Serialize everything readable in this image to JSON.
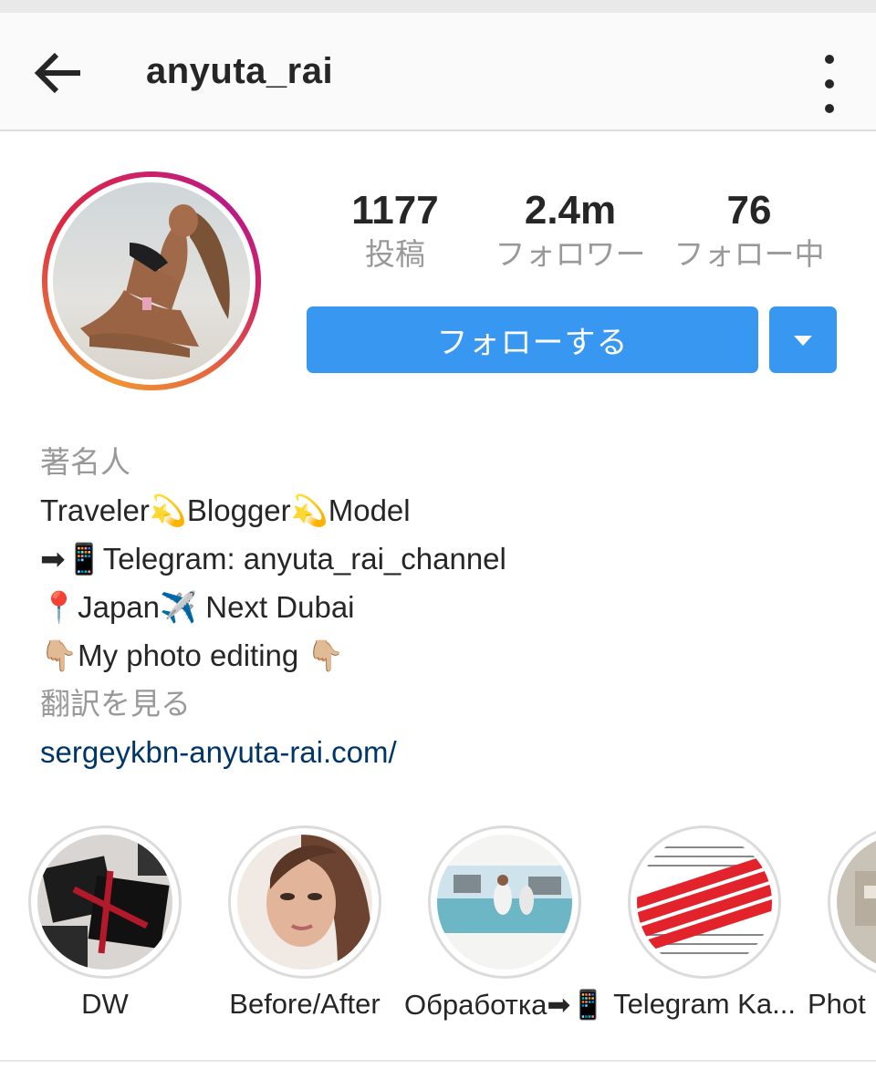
{
  "header": {
    "username": "anyuta_rai",
    "back_icon": "arrow-left-icon",
    "more_icon": "more-vertical-icon"
  },
  "stats": {
    "posts": {
      "value": "1177",
      "label": "投稿"
    },
    "followers": {
      "value": "2.4m",
      "label": "フォロワー"
    },
    "following": {
      "value": "76",
      "label": "フォロー中"
    }
  },
  "actions": {
    "follow_label": "フォローする",
    "dropdown_icon": "caret-down-icon",
    "accent_color": "#3897f0"
  },
  "bio": {
    "category": "著名人",
    "lines": [
      "Traveler💫Blogger💫Model",
      "➡📱Telegram: anyuta_rai_channel",
      "📍Japan✈️ Next Dubai",
      "👇🏼My photo editing 👇🏼"
    ],
    "translate_label": "翻訳を見る",
    "link": "sergeykbn-anyuta-rai.com/"
  },
  "highlights": [
    {
      "label": "DW"
    },
    {
      "label": "Before/After"
    },
    {
      "label": "Обработка➡📱"
    },
    {
      "label": "Telegram Ka..."
    },
    {
      "label": "Phot"
    }
  ]
}
